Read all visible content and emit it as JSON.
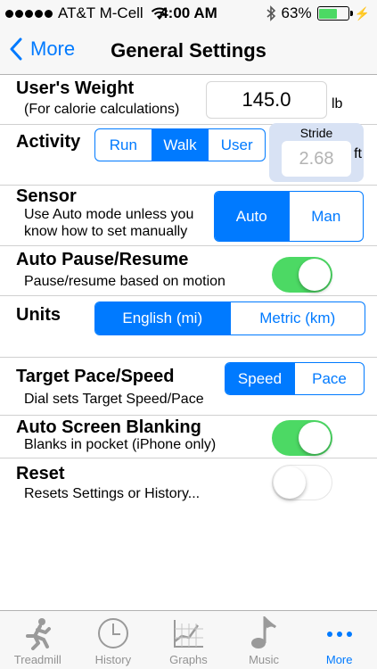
{
  "status": {
    "carrier": "AT&T M-Cell",
    "time": "4:00 AM",
    "battery": "63%",
    "battery_level": 0.63
  },
  "nav": {
    "back_label": "More",
    "title": "General Settings"
  },
  "weight": {
    "title": "User's Weight",
    "subtitle": "(For calorie calculations)",
    "value": "145.0",
    "unit": "lb"
  },
  "activity": {
    "title": "Activity",
    "options": [
      "Run",
      "Walk",
      "User"
    ],
    "selected": "Walk",
    "stride_label": "Stride",
    "stride_value": "2.68",
    "stride_unit": "ft"
  },
  "sensor": {
    "title": "Sensor",
    "subtitle_line1": "Use Auto mode unless you",
    "subtitle_line2": "know how to set manually",
    "options": [
      "Auto",
      "Man"
    ],
    "selected": "Auto"
  },
  "auto_pause": {
    "title": "Auto Pause/Resume",
    "subtitle": "Pause/resume based on motion",
    "on": true
  },
  "units": {
    "title": "Units",
    "options": [
      "English (mi)",
      "Metric (km)"
    ],
    "selected": "English (mi)"
  },
  "target": {
    "title": "Target Pace/Speed",
    "subtitle": "Dial sets Target Speed/Pace",
    "options": [
      "Speed",
      "Pace"
    ],
    "selected": "Speed"
  },
  "blanking": {
    "title": "Auto Screen Blanking",
    "subtitle": "Blanks in pocket (iPhone only)",
    "on": true
  },
  "reset": {
    "title": "Reset",
    "subtitle": "Resets Settings or History...",
    "on": false
  },
  "tabs": [
    {
      "label": "Treadmill",
      "icon": "runner-icon"
    },
    {
      "label": "History",
      "icon": "clock-icon"
    },
    {
      "label": "Graphs",
      "icon": "graph-icon"
    },
    {
      "label": "Music",
      "icon": "music-note-icon"
    },
    {
      "label": "More",
      "icon": "more-dots-icon",
      "active": true
    }
  ],
  "colors": {
    "accent": "#007aff",
    "toggle_on": "#4cd964",
    "stride_bg": "#d8e2f4"
  }
}
